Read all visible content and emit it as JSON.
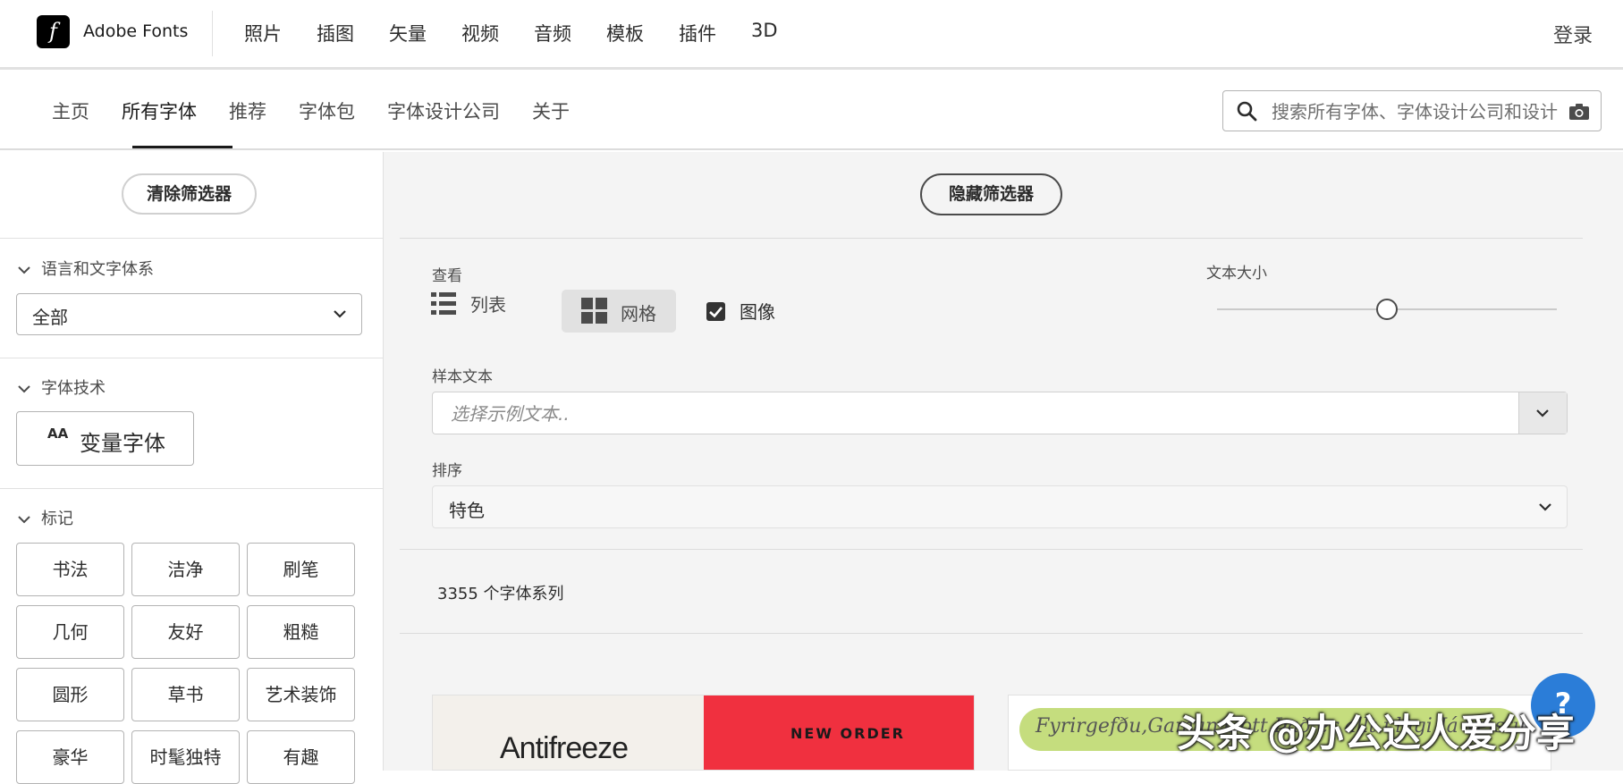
{
  "topbar": {
    "logo_glyph": "f",
    "brand": "Adobe Fonts",
    "nav": [
      "照片",
      "插图",
      "矢量",
      "视频",
      "音频",
      "模板",
      "插件",
      "3D"
    ],
    "login": "登录"
  },
  "subnav": {
    "items": [
      "主页",
      "所有字体",
      "推荐",
      "字体包",
      "字体设计公司",
      "关于"
    ],
    "active_index": 1,
    "search_placeholder": "搜索所有字体、字体设计公司和设计"
  },
  "sidebar": {
    "clear_filters": "清除筛选器",
    "language_section": "语言和文字体系",
    "language_value": "全部",
    "tech_section": "字体技术",
    "variable_fonts_icon_text": "AA",
    "variable_fonts": "变量字体",
    "tags_section": "标记",
    "tags": [
      "书法",
      "洁净",
      "刷笔",
      "几何",
      "友好",
      "粗糙",
      "圆形",
      "草书",
      "艺术装饰",
      "豪华",
      "时髦独特",
      "有趣"
    ]
  },
  "main": {
    "hide_filters": "隐藏筛选器",
    "view_label": "查看",
    "view_list": "列表",
    "view_grid": "网格",
    "images_checked": true,
    "images_label": "图像",
    "text_size_label": "文本大小",
    "text_size_value": 0.5,
    "sample_text_label": "样本文本",
    "sample_text_placeholder": "选择示例文本..",
    "sort_label": "排序",
    "sort_value": "特色",
    "family_count": "3355 个字体系列",
    "cards": [
      {
        "left_text": "Antifreeze",
        "right_text": "NEW ORDER"
      },
      {
        "script_text": "Fyrirgefðu,Gaman Gott Það er allt í lagi Já Veistu"
      }
    ]
  },
  "help_label": "?",
  "watermark": "头条 @办公达人爱分享",
  "colors": {
    "accent_red": "#f0303f",
    "help_blue": "#2b7dd8",
    "card_green": "#c5dd7e"
  }
}
